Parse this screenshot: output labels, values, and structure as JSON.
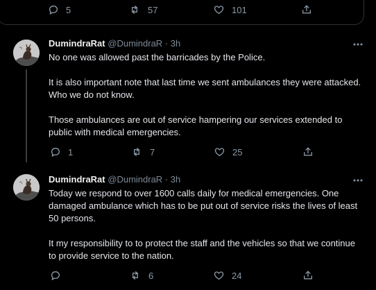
{
  "top_actions": {
    "replies": "5",
    "retweets": "57",
    "likes": "101"
  },
  "tweets": [
    {
      "display_name": "DumindraRat",
      "handle": "@DumindraR",
      "separator": " · ",
      "time": "3h",
      "paragraphs": [
        "No one was allowed past the barricades by the Police.",
        "It is also important note that last time we sent ambulances they were attacked. Who we do not know.",
        "Those ambulances are out of service hampering our services extended to public with medical emergencies."
      ],
      "replies": "1",
      "retweets": "7",
      "likes": "25"
    },
    {
      "display_name": "DumindraRat",
      "handle": "@DumindraR",
      "separator": " · ",
      "time": "3h",
      "paragraphs": [
        "Today we respond to over 1600 calls daily for medical emergencies. One damaged ambulance which has to be put out of service risks the lives of least 50 persons.",
        "It my responsibility to to protect the staff and the vehicles so that we continue to provide service to the nation."
      ],
      "replies": "",
      "retweets": "6",
      "likes": "24"
    }
  ],
  "icons": [
    "reply-icon",
    "retweet-icon",
    "like-icon",
    "share-icon",
    "more-icon"
  ],
  "colors": {
    "background": "#000000",
    "text": "#e4e6eb",
    "muted": "#8b98a5",
    "border": "#2f3336"
  }
}
